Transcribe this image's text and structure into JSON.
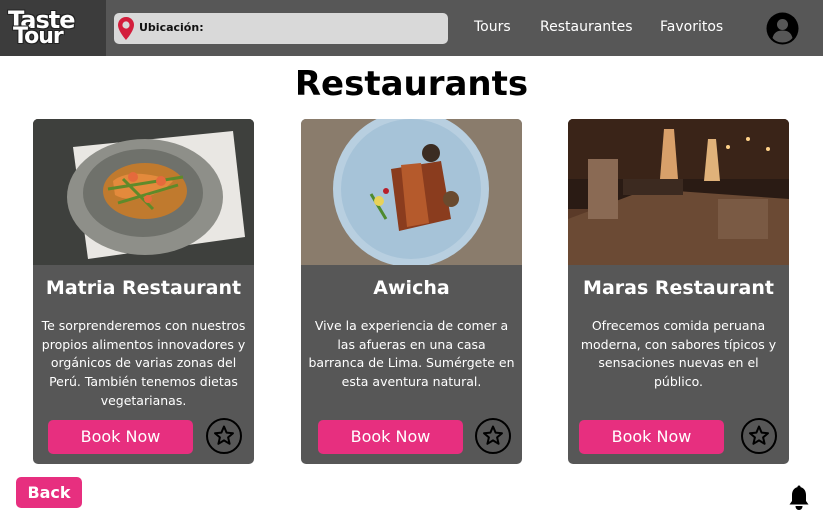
{
  "header": {
    "logo_line1": "Taste",
    "logo_line2": "Tour",
    "location_label": "Ubicación:",
    "nav": [
      "Tours",
      "Restaurantes",
      "Favoritos"
    ]
  },
  "page_title": "Restaurants",
  "restaurants": [
    {
      "name": "Matria Restaurant",
      "description": "Te sorprenderemos con nuestros propios alimentos innovadores y orgánicos de varias zonas del Perú. También tenemos dietas vegetarianas.",
      "book_label": "Book Now"
    },
    {
      "name": "Awicha",
      "description": "Vive la experiencia de comer a las afueras en una casa barranca de Lima. Sumérgete en esta aventura natural.",
      "book_label": "Book Now"
    },
    {
      "name": "Maras Restaurant",
      "description": "Ofrecemos comida peruana moderna, con sabores típicos y sensaciones nuevas en el público.",
      "book_label": "Book Now"
    }
  ],
  "back_label": "Back",
  "colors": {
    "navbar": "#575757",
    "accent": "#e72f7f",
    "card": "#575757",
    "pin": "#d31e3c"
  },
  "icons": [
    "location-pin-icon",
    "user-avatar-icon",
    "star-icon",
    "bell-icon"
  ]
}
